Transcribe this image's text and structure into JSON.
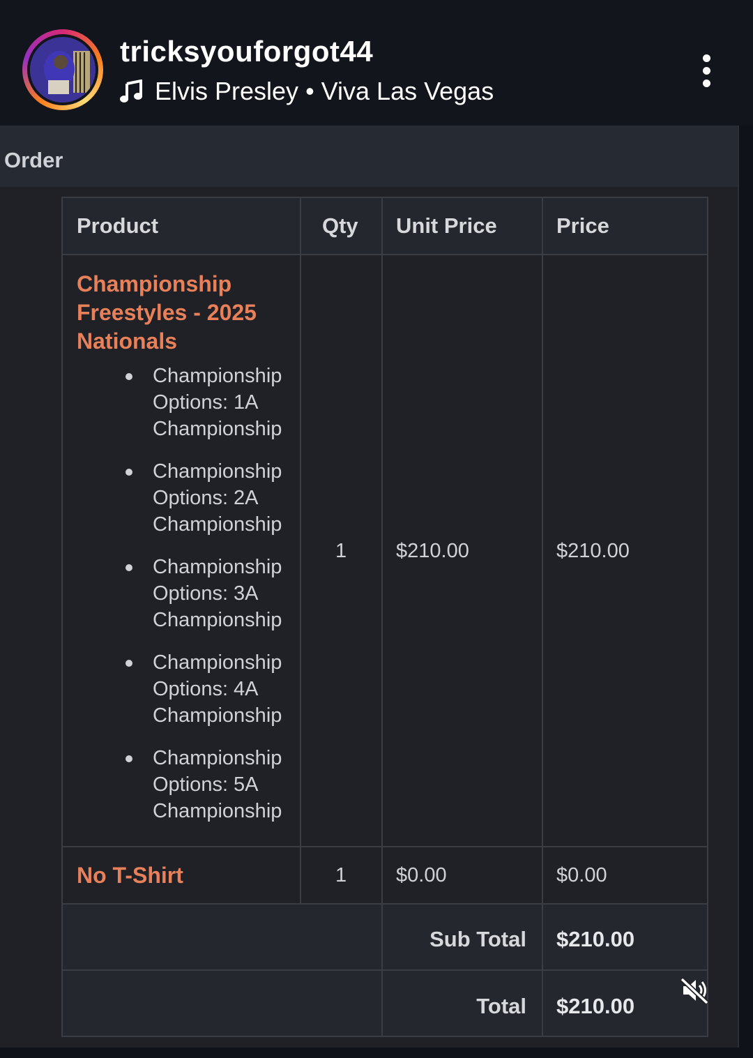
{
  "story": {
    "username": "tricksyouforgot44",
    "music_artist": "Elvis Presley",
    "music_separator": "•",
    "music_song": "Viva Las Vegas",
    "music_icon": "music-note-icon",
    "more_icon": "more-vertical-icon"
  },
  "order": {
    "title": "Order",
    "columns": {
      "product": "Product",
      "qty": "Qty",
      "unit_price": "Unit Price",
      "price": "Price"
    },
    "items": [
      {
        "title_lines": [
          "Championship",
          "Freestyles - 2025",
          "Nationals"
        ],
        "options": [
          [
            "Championship",
            "Options: 1A",
            "Championship"
          ],
          [
            "Championship",
            "Options: 2A",
            "Championship"
          ],
          [
            "Championship",
            "Options: 3A",
            "Championship"
          ],
          [
            "Championship",
            "Options: 4A",
            "Championship"
          ],
          [
            "Championship",
            "Options: 5A",
            "Championship"
          ]
        ],
        "qty": "1",
        "unit_price": "$210.00",
        "price": "$210.00"
      },
      {
        "title_lines": [
          "No T-Shirt"
        ],
        "qty": "1",
        "unit_price": "$0.00",
        "price": "$0.00"
      }
    ],
    "sub_total_label": "Sub Total",
    "sub_total_value": "$210.00",
    "total_label": "Total",
    "total_value": "$210.00"
  },
  "overlay": {
    "mute_icon": "speaker-muted-icon"
  },
  "colors": {
    "accent_product": "#e8805a",
    "background": "#1f2127"
  }
}
